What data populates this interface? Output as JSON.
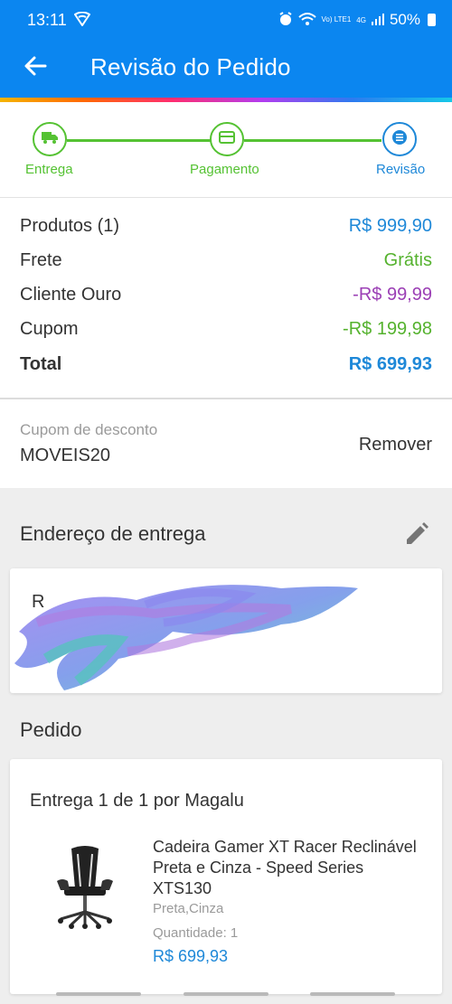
{
  "status_bar": {
    "time": "13:11",
    "battery": "50%",
    "network_label": "Vo) LTE1",
    "network_gen": "4G"
  },
  "header": {
    "title": "Revisão do Pedido"
  },
  "stepper": {
    "steps": [
      {
        "label": "Entrega",
        "icon": "truck-icon",
        "state": "done"
      },
      {
        "label": "Pagamento",
        "icon": "card-icon",
        "state": "done"
      },
      {
        "label": "Revisão",
        "icon": "list-icon",
        "state": "active"
      }
    ]
  },
  "summary": {
    "rows": [
      {
        "label": "Produtos (1)",
        "value": "R$ 999,90",
        "color": "#1e88d8"
      },
      {
        "label": "Frete",
        "value": "Grátis",
        "color": "#55b22e"
      },
      {
        "label": "Cliente Ouro",
        "value": "-R$ 99,99",
        "color": "#9b3fb5"
      },
      {
        "label": "Cupom",
        "value": "-R$ 199,98",
        "color": "#55b22e"
      }
    ],
    "total": {
      "label": "Total",
      "value": "R$ 699,93",
      "color": "#1e88d8"
    }
  },
  "coupon": {
    "label": "Cupom de desconto",
    "code": "MOVEIS20",
    "remove_label": "Remover"
  },
  "address": {
    "title": "Endereço de entrega",
    "visible_start": "R"
  },
  "order": {
    "title": "Pedido",
    "shipment": "Entrega 1 de 1 por Magalu",
    "product": {
      "name": "Cadeira Gamer XT Racer Reclinável Preta e Cinza - Speed Series XTS130",
      "variant": "Preta,Cinza",
      "quantity": "Quantidade:  1",
      "price": "R$ 699,93"
    }
  },
  "colors": {
    "brand_blue": "#0b86f0",
    "step_green": "#55c233",
    "price_blue": "#1e88d8"
  }
}
